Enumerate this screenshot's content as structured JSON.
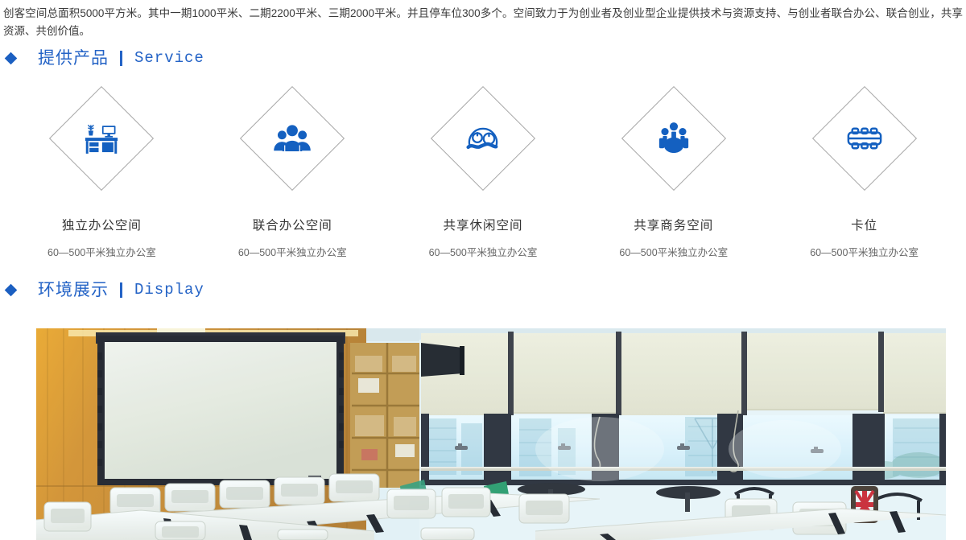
{
  "intro": {
    "text": "创客空间总面积5000平方米。其中一期1000平米、二期2200平米、三期2000平米。并且停车位300多个。空间致力于为创业者及创业型企业提供技术与资源支持、与创业者联合办公、联合创业，共享资源、共创价值。"
  },
  "theme": {
    "accent": "#2463c6",
    "bullet": "#1b5fc1",
    "icon_blue": "#1460c0",
    "diamond_outline": "#a6a6a6",
    "title_color": "#333333",
    "desc_color": "#666666"
  },
  "sections": {
    "service": {
      "bullet": "diamond-bullet",
      "title_cn": "提供产品",
      "divider": "|",
      "title_en": "Service"
    },
    "display": {
      "bullet": "diamond-bullet",
      "title_cn": "环境展示",
      "divider": "|",
      "title_en": "Display"
    }
  },
  "products": [
    {
      "icon": "desk-computer-icon",
      "title": "独立办公空间",
      "desc": "60—500平米独立办公室"
    },
    {
      "icon": "people-group-icon",
      "title": "联合办公空间",
      "desc": "60—500平米独立办公室"
    },
    {
      "icon": "relax-face-wave-icon",
      "title": "共享休闲空间",
      "desc": "60—500平米独立办公室"
    },
    {
      "icon": "meeting-table-people-icon",
      "title": "共享商务空间",
      "desc": "60—500平米独立办公室"
    },
    {
      "icon": "workstation-bench-icon",
      "title": "卡位",
      "desc": "60—500平米独立办公室"
    }
  ],
  "display_photo": {
    "alt": "会议培训室照片：投影幕布、木质墙面、书架、白色长桌与座椅、落地窗"
  }
}
